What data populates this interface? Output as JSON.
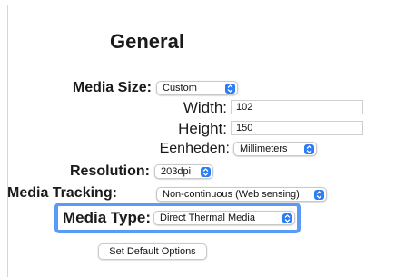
{
  "title": "General",
  "media_size": {
    "label": "Media Size:",
    "value": "Custom"
  },
  "width": {
    "label": "Width:",
    "value": "102"
  },
  "height": {
    "label": "Height:",
    "value": "150"
  },
  "units": {
    "label": "Eenheden:",
    "value": "Millimeters"
  },
  "resolution": {
    "label": "Resolution:",
    "value": "203dpi"
  },
  "media_tracking": {
    "label": "Media Tracking:",
    "value": "Non-continuous (Web sensing)"
  },
  "media_type": {
    "label": "Media Type:",
    "value": "Direct Thermal Media"
  },
  "default_button": {
    "label": "Set Default Options"
  },
  "colors": {
    "accent": "#2a7cf7",
    "highlight": "#5b9bf8"
  },
  "icons": {
    "select_arrow": "chevron-up-down-icon"
  }
}
